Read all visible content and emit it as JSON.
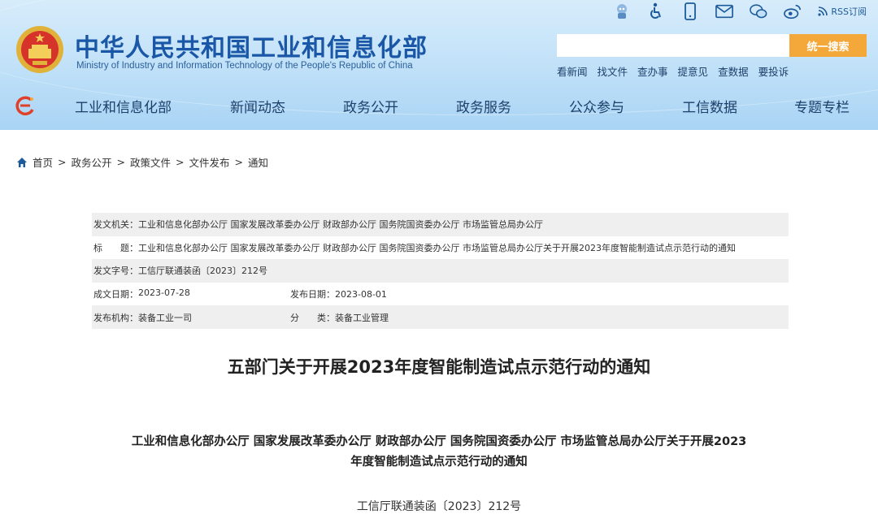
{
  "header": {
    "title": "中华人民共和国工业和信息化部",
    "subtitle": "Ministry of Industry and Information Technology of the People's Republic of China",
    "rss_label": "RSS订阅",
    "search": {
      "placeholder": "",
      "button_label": "统一搜索"
    },
    "quick_links": [
      "看新闻",
      "找文件",
      "查办事",
      "提意见",
      "查数据",
      "要投诉"
    ],
    "icons": [
      "robot-assistant-icon",
      "accessibility-icon",
      "mobile-icon",
      "mail-icon",
      "wechat-icon",
      "weibo-icon"
    ]
  },
  "nav": {
    "items": [
      "工业和信息化部",
      "新闻动态",
      "政务公开",
      "政务服务",
      "公众参与",
      "工信数据",
      "专题专栏"
    ]
  },
  "breadcrumb": [
    "首页",
    "政务公开",
    "政策文件",
    "文件发布",
    "通知"
  ],
  "meta": {
    "issuer_label": "发文机关：",
    "issuer": "工业和信息化部办公厅 国家发展改革委办公厅 财政部办公厅 国务院国资委办公厅 市场监管总局办公厅",
    "title_label": "标　　题：",
    "title": "工业和信息化部办公厅 国家发展改革委办公厅 财政部办公厅 国务院国资委办公厅 市场监管总局办公厅关于开展2023年度智能制造试点示范行动的通知",
    "doc_no_label": "发文字号：",
    "doc_no": "工信厅联通装函〔2023〕212号",
    "created_label": "成文日期：",
    "created": "2023-07-28",
    "published_label": "发布日期：",
    "published": "2023-08-01",
    "org_label": "发布机构：",
    "org": "装备工业一司",
    "category_label": "分　　类：",
    "category": "装备工业管理"
  },
  "article": {
    "title": "五部门关于开展2023年度智能制造试点示范行动的通知",
    "subtitle_line1": "工业和信息化部办公厅  国家发展改革委办公厅  财政部办公厅  国务院国资委办公厅  市场监管总局办公厅关于开展2023",
    "subtitle_line2": "年度智能制造试点示范行动的通知",
    "doc_no": "工信厅联通装函〔2023〕212号"
  },
  "colors": {
    "brand_blue": "#1a57a6",
    "search_orange": "#f4a83a",
    "header_bg": "#bfe0f8",
    "meta_shade": "#efefef"
  }
}
